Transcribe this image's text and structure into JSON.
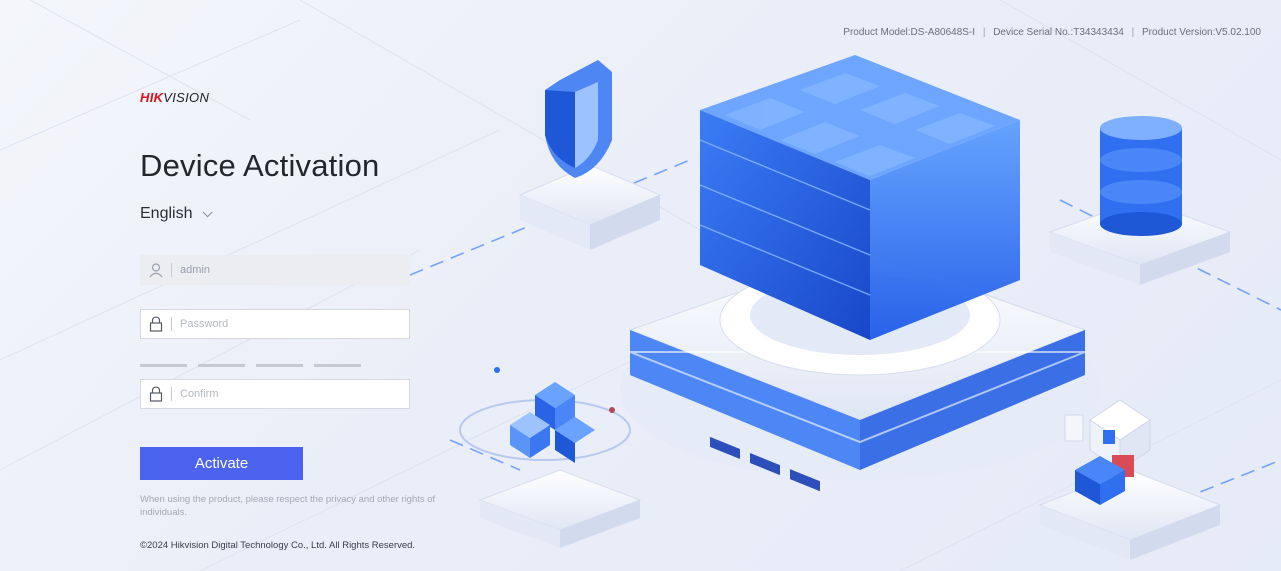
{
  "header": {
    "product_model": "Product Model:DS-A80648S-I",
    "serial": "Device Serial No.:T34343434",
    "version": "Product Version:V5.02.100",
    "separator": "|"
  },
  "brand": {
    "logo_red": "HIK",
    "logo_dark": "VISION"
  },
  "page": {
    "title": "Device Activation"
  },
  "language": {
    "selected": "English"
  },
  "form": {
    "username_value": "admin",
    "password_placeholder": "Password",
    "confirm_placeholder": "Confirm",
    "strength_segments": 4,
    "activate_label": "Activate"
  },
  "footer": {
    "notice": "When using the product, please respect the privacy and other rights of individuals.",
    "copyright": "©2024 Hikvision Digital Technology Co., Ltd. All Rights Reserved."
  },
  "colors": {
    "accent": "#4c63f0",
    "brand_red": "#d7141a",
    "illustration_blue": "#2f6ff0"
  },
  "icons": {
    "user": "user-icon",
    "lock": "lock-icon",
    "chevron": "chevron-down-icon"
  }
}
